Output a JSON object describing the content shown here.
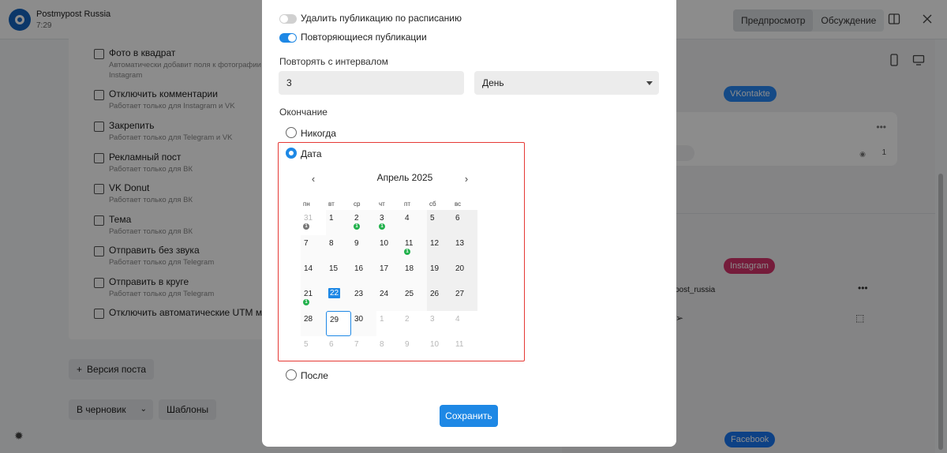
{
  "app": {
    "account_name": "Postmypost Russia",
    "account_time": "7:29",
    "preview_tab": "Предпросмотр",
    "discussion_tab": "Обсуждение"
  },
  "left_options": [
    {
      "title": "Фото в квадрат",
      "sub1": "Автоматически добавит поля к фотографии",
      "sub2": "Instagram"
    },
    {
      "title": "Отключить комментарии",
      "sub1": "Работает только для Instagram и VK"
    },
    {
      "title": "Закрепить",
      "sub1": "Работает только для Telegram и VK"
    },
    {
      "title": "Рекламный пост",
      "sub1": "Работает только для ВК"
    },
    {
      "title": "VK Donut",
      "sub1": "Работает только для ВК"
    },
    {
      "title": "Тема",
      "sub1": "Работает только для ВК"
    },
    {
      "title": "Отправить без звука",
      "sub1": "Работает только для Telegram"
    },
    {
      "title": "Отправить в круге",
      "sub1": "Работает только для Telegram"
    },
    {
      "title": "Отключить автоматические UTM метки"
    }
  ],
  "left_actions": {
    "version_post": "Версия поста",
    "draft": "В черновик",
    "templates": "Шаблоны"
  },
  "right_pane": {
    "vk_chip": "VKontakte",
    "vk_views": "1",
    "ig_chip": "Instagram",
    "ig_account": "ypost_russia",
    "fb_chip": "Facebook"
  },
  "modal": {
    "delete_scheduled": "Удалить публикацию по расписанию",
    "repeat_posts": "Повторяющиеся публикации",
    "interval_label": "Повторять с интервалом",
    "interval_value": "3",
    "interval_unit": "День",
    "ending_label": "Окончание",
    "never": "Никогда",
    "date": "Дата",
    "after": "После",
    "save": "Сохранить"
  },
  "calendar": {
    "month": "Апрель 2025",
    "weekdays": [
      "пн",
      "вт",
      "ср",
      "чт",
      "пт",
      "сб",
      "вс"
    ],
    "weeks": [
      [
        "31",
        "1",
        "2",
        "3",
        "4",
        "5",
        "6"
      ],
      [
        "7",
        "8",
        "9",
        "10",
        "11",
        "12",
        "13"
      ],
      [
        "14",
        "15",
        "16",
        "17",
        "18",
        "19",
        "20"
      ],
      [
        "21",
        "22",
        "23",
        "24",
        "25",
        "26",
        "27"
      ],
      [
        "28",
        "29",
        "30",
        "1",
        "2",
        "3",
        "4"
      ],
      [
        "5",
        "6",
        "7",
        "8",
        "9",
        "10",
        "11"
      ]
    ],
    "badge": "1"
  },
  "colors": {
    "accent": "#1e88e5",
    "highlight_border": "#e53935",
    "badge_green": "#22b14c",
    "badge_gray": "#777777",
    "vk": "#2787f5",
    "instagram": "#d6336c",
    "facebook": "#1877f2"
  }
}
